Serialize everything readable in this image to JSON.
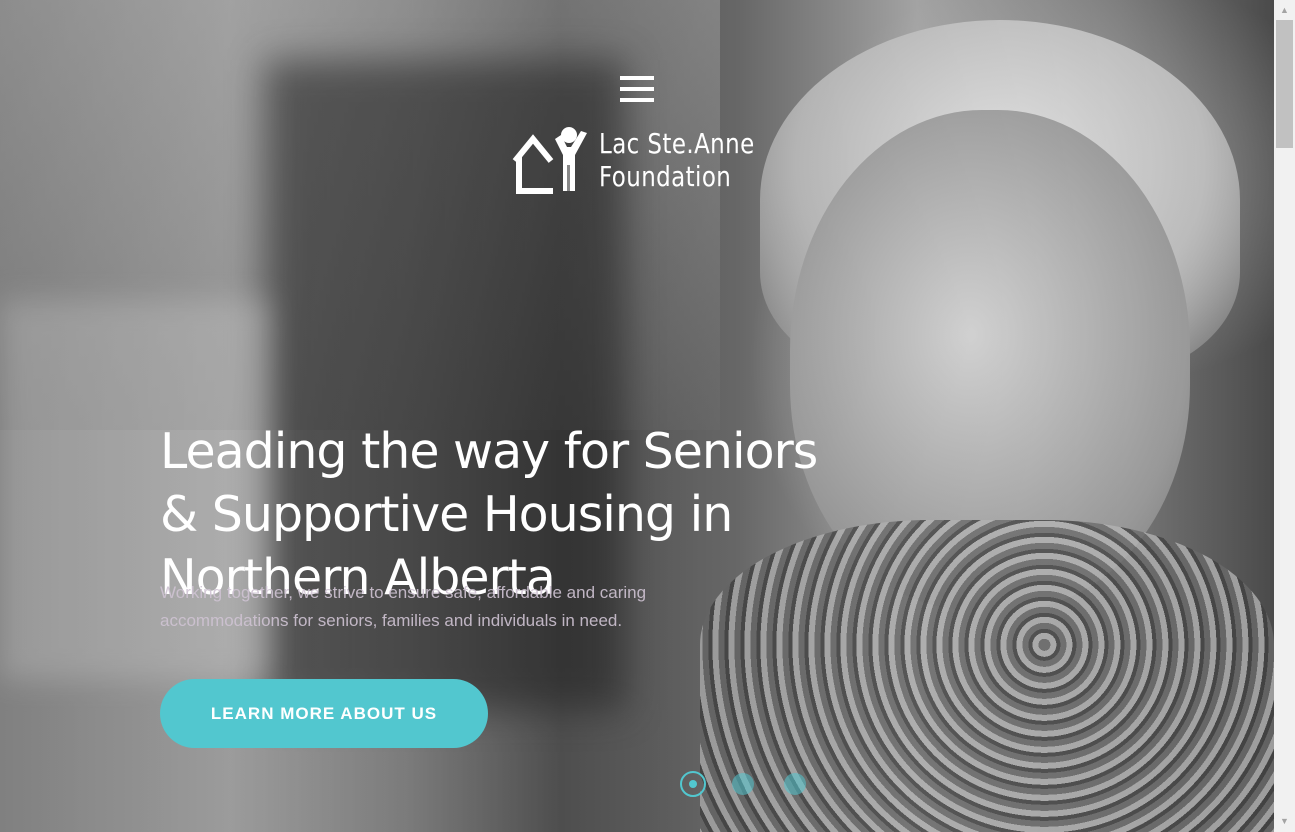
{
  "header": {
    "menu_icon": "hamburger-menu-icon",
    "logo": {
      "icon": "house-person-logo-icon",
      "line1": "Lac Ste.Anne",
      "line2": "Foundation"
    }
  },
  "hero": {
    "headline": "Leading the way for Seniors & Supportive Housing in Northern Alberta",
    "subtext": "Working together, we strive to ensure safe, affordable and caring accommodations for seniors, families and individuals in need.",
    "cta_label": "LEARN MORE ABOUT US",
    "slides": {
      "count": 3,
      "active": 1
    }
  },
  "colors": {
    "accent": "#52c7cf",
    "text": "#ffffff",
    "subtext": "#cfc3d3"
  },
  "scrollbar": {
    "up_icon": "scroll-up-arrow-icon",
    "down_icon": "scroll-down-arrow-icon"
  }
}
